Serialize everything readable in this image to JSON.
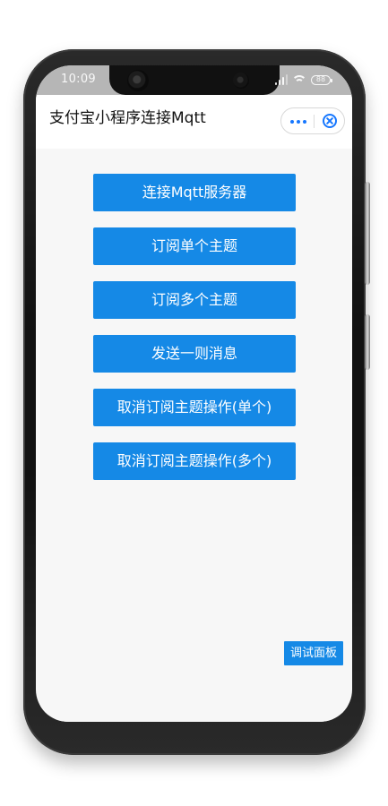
{
  "status_bar": {
    "time": "10:09",
    "battery": "88"
  },
  "header": {
    "title": "支付宝小程序连接Mqtt"
  },
  "buttons": [
    {
      "label": "连接Mqtt服务器"
    },
    {
      "label": "订阅单个主题"
    },
    {
      "label": "订阅多个主题"
    },
    {
      "label": "发送一则消息"
    },
    {
      "label": "取消订阅主题操作(单个)"
    },
    {
      "label": "取消订阅主题操作(多个)"
    }
  ],
  "debug_panel": {
    "label": "调试面板"
  },
  "icons": {
    "more": "more-icon",
    "close": "close-icon",
    "signal": "signal-icon",
    "wifi": "wifi-icon",
    "battery": "battery-icon"
  },
  "colors": {
    "accent": "#1589e6",
    "capsule_icon": "#1677ff",
    "screen_bg": "#f7f7f7",
    "status_bg": "#b6b6b6"
  }
}
